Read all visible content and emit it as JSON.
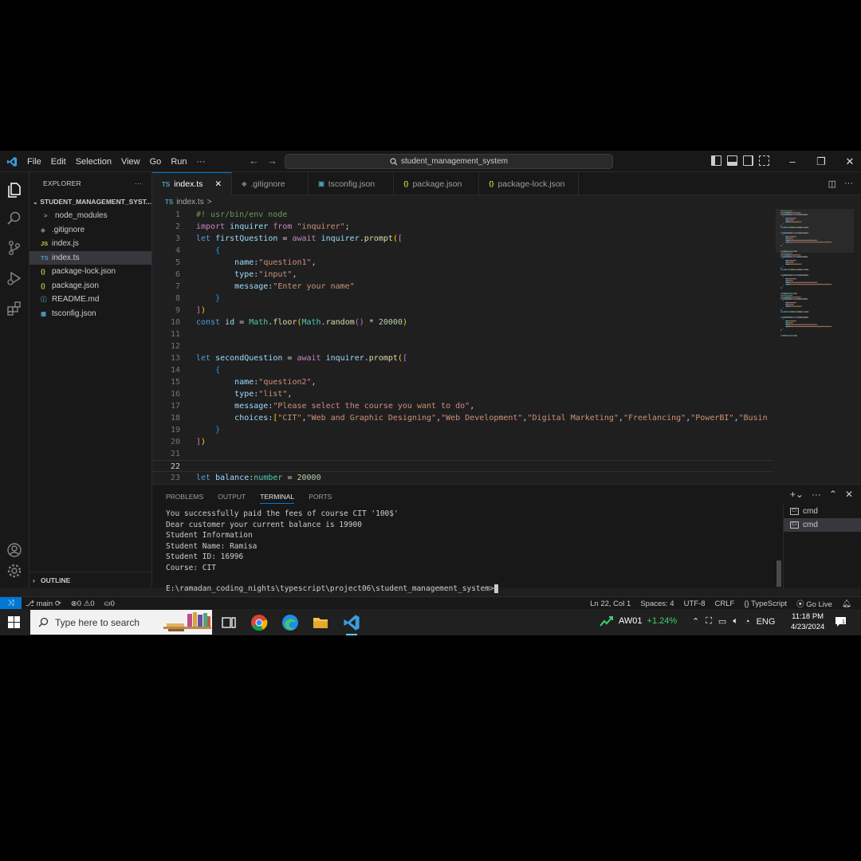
{
  "titlebar": {
    "menu": [
      "File",
      "Edit",
      "Selection",
      "View",
      "Go",
      "Run",
      "···"
    ],
    "search": "student_management_system"
  },
  "sidebar": {
    "title": "EXPLORER",
    "folder": "STUDENT_MANAGEMENT_SYST...",
    "items": [
      {
        "icon": ">",
        "label": "node_modules",
        "icon_color": "#9d9d9d"
      },
      {
        "icon": "◆",
        "label": ".gitignore",
        "icon_color": "#6e7681"
      },
      {
        "icon": "JS",
        "label": "index.js",
        "icon_color": "#cbcb41"
      },
      {
        "icon": "TS",
        "label": "index.ts",
        "icon_color": "#519aba"
      },
      {
        "icon": "{}",
        "label": "package-lock.json",
        "icon_color": "#cbcb41"
      },
      {
        "icon": "{}",
        "label": "package.json",
        "icon_color": "#cbcb41"
      },
      {
        "icon": "ⓘ",
        "label": "README.md",
        "icon_color": "#519aba"
      },
      {
        "icon": "▣",
        "label": "tsconfig.json",
        "icon_color": "#519aba"
      }
    ],
    "outline": "OUTLINE"
  },
  "tabs": [
    {
      "icon": "TS",
      "label": "index.ts",
      "icon_color": "#519aba"
    },
    {
      "icon": "◆",
      "label": ".gitignore",
      "icon_color": "#6e7681"
    },
    {
      "icon": "▣",
      "label": "tsconfig.json",
      "icon_color": "#519aba"
    },
    {
      "icon": "{}",
      "label": "package.json",
      "icon_color": "#cbcb41"
    },
    {
      "icon": "{}",
      "label": "package-lock.json",
      "icon_color": "#cbcb41"
    }
  ],
  "breadcrumb": {
    "icon": "TS",
    "file": "index.ts",
    "sep": ">"
  },
  "code": [
    {
      "n": "1",
      "t": [
        [
          "cm",
          "#! usr/bin/env node"
        ]
      ]
    },
    {
      "n": "2",
      "t": [
        [
          "kw2",
          "import "
        ],
        [
          "vr",
          "inquirer "
        ],
        [
          "kw2",
          "from "
        ],
        [
          "str",
          "\"inquirer\""
        ],
        [
          "pl",
          ";"
        ]
      ]
    },
    {
      "n": "3",
      "t": [
        [
          "kw",
          "let "
        ],
        [
          "vr",
          "firstQuestion "
        ],
        [
          "pl",
          "= "
        ],
        [
          "kw2",
          "await "
        ],
        [
          "vr",
          "inquirer"
        ],
        [
          "pl",
          "."
        ],
        [
          "fn",
          "prompt"
        ],
        [
          "br1",
          "("
        ],
        [
          "br2",
          "["
        ]
      ]
    },
    {
      "n": "4",
      "t": [
        [
          "pl",
          "    "
        ],
        [
          "br3",
          "{"
        ]
      ]
    },
    {
      "n": "5",
      "t": [
        [
          "pl",
          "        "
        ],
        [
          "vr",
          "name"
        ],
        [
          "pl",
          ":"
        ],
        [
          "str",
          "\"question1\""
        ],
        [
          "pl",
          ","
        ]
      ]
    },
    {
      "n": "6",
      "t": [
        [
          "pl",
          "        "
        ],
        [
          "vr",
          "type"
        ],
        [
          "pl",
          ":"
        ],
        [
          "str",
          "\"input\""
        ],
        [
          "pl",
          ","
        ]
      ]
    },
    {
      "n": "7",
      "t": [
        [
          "pl",
          "        "
        ],
        [
          "vr",
          "message"
        ],
        [
          "pl",
          ":"
        ],
        [
          "str",
          "\"Enter your name\""
        ]
      ]
    },
    {
      "n": "8",
      "t": [
        [
          "pl",
          "    "
        ],
        [
          "br3",
          "}"
        ]
      ]
    },
    {
      "n": "9",
      "t": [
        [
          "br2",
          "]"
        ],
        [
          "br1",
          ")"
        ]
      ]
    },
    {
      "n": "10",
      "t": [
        [
          "kw",
          "const "
        ],
        [
          "vr",
          "id "
        ],
        [
          "pl",
          "= "
        ],
        [
          "ty",
          "Math"
        ],
        [
          "pl",
          "."
        ],
        [
          "fn",
          "floor"
        ],
        [
          "br1",
          "("
        ],
        [
          "ty",
          "Math"
        ],
        [
          "pl",
          "."
        ],
        [
          "fn",
          "random"
        ],
        [
          "br2",
          "()"
        ],
        [
          "pl",
          " * "
        ],
        [
          "nm",
          "20000"
        ],
        [
          "br1",
          ")"
        ]
      ]
    },
    {
      "n": "11",
      "t": []
    },
    {
      "n": "12",
      "t": []
    },
    {
      "n": "13",
      "t": [
        [
          "kw",
          "let "
        ],
        [
          "vr",
          "secondQuestion "
        ],
        [
          "pl",
          "= "
        ],
        [
          "kw2",
          "await "
        ],
        [
          "vr",
          "inquirer"
        ],
        [
          "pl",
          "."
        ],
        [
          "fn",
          "prompt"
        ],
        [
          "br1",
          "("
        ],
        [
          "br2",
          "["
        ]
      ]
    },
    {
      "n": "14",
      "t": [
        [
          "pl",
          "    "
        ],
        [
          "br3",
          "{"
        ]
      ]
    },
    {
      "n": "15",
      "t": [
        [
          "pl",
          "        "
        ],
        [
          "vr",
          "name"
        ],
        [
          "pl",
          ":"
        ],
        [
          "str",
          "\"question2\""
        ],
        [
          "pl",
          ","
        ]
      ]
    },
    {
      "n": "16",
      "t": [
        [
          "pl",
          "        "
        ],
        [
          "vr",
          "type"
        ],
        [
          "pl",
          ":"
        ],
        [
          "str",
          "\"list\""
        ],
        [
          "pl",
          ","
        ]
      ]
    },
    {
      "n": "17",
      "t": [
        [
          "pl",
          "        "
        ],
        [
          "vr",
          "message"
        ],
        [
          "pl",
          ":"
        ],
        [
          "str",
          "\"Please select the course you want to do\""
        ],
        [
          "pl",
          ","
        ]
      ]
    },
    {
      "n": "18",
      "t": [
        [
          "pl",
          "        "
        ],
        [
          "vr",
          "choices"
        ],
        [
          "pl",
          ":"
        ],
        [
          "br1",
          "["
        ],
        [
          "str",
          "\"CIT\""
        ],
        [
          "pl",
          ","
        ],
        [
          "str",
          "\"Web and Graphic Designing\""
        ],
        [
          "pl",
          ","
        ],
        [
          "str",
          "\"Web Development\""
        ],
        [
          "pl",
          ","
        ],
        [
          "str",
          "\"Digital Marketing\""
        ],
        [
          "pl",
          ","
        ],
        [
          "str",
          "\"Freelancing\""
        ],
        [
          "pl",
          ","
        ],
        [
          "str",
          "\"PowerBI\""
        ],
        [
          "pl",
          ","
        ],
        [
          "str",
          "\"Busin"
        ]
      ]
    },
    {
      "n": "19",
      "t": [
        [
          "pl",
          "    "
        ],
        [
          "br3",
          "}"
        ]
      ]
    },
    {
      "n": "20",
      "t": [
        [
          "br2",
          "]"
        ],
        [
          "br1",
          ")"
        ]
      ]
    },
    {
      "n": "21",
      "t": []
    },
    {
      "n": "22",
      "t": [],
      "current": true
    },
    {
      "n": "23",
      "t": [
        [
          "kw",
          "let "
        ],
        [
          "vr",
          "balance"
        ],
        [
          "pl",
          ":"
        ],
        [
          "ty",
          "number "
        ],
        [
          "pl",
          "= "
        ],
        [
          "nm",
          "20000"
        ]
      ]
    }
  ],
  "panel": {
    "tabs": [
      "PROBLEMS",
      "OUTPUT",
      "TERMINAL",
      "PORTS"
    ],
    "active_tab": "TERMINAL",
    "terminal_lines": [
      "You successfully paid the fees of course CIT '100$'",
      "Dear customer your current balance is 19900",
      "Student Information",
      "Student Name: Ramisa",
      "Student ID: 16996",
      "Course: CIT"
    ],
    "prompt": "E:\\ramadan_coding_nights\\typescript\\project06\\student_management_system>",
    "terminals": [
      "cmd",
      "cmd"
    ]
  },
  "statusbar": {
    "branch": "main",
    "errors": "0",
    "warnings": "0",
    "ports": "0",
    "position": "Ln 22, Col 1",
    "spaces": "Spaces: 4",
    "encoding": "UTF-8",
    "eol": "CRLF",
    "language": "TypeScript",
    "golive": "Go Live"
  },
  "taskbar": {
    "search_placeholder": "Type here to search",
    "stock_name": "AW01",
    "stock_change": "+1.24%",
    "lang": "ENG",
    "time": "11:18 PM",
    "date": "4/23/2024",
    "notifications": "1"
  },
  "colors": {
    "accent": "#0078d4",
    "bg": "#1f1f1f",
    "chrome": "#181818"
  }
}
